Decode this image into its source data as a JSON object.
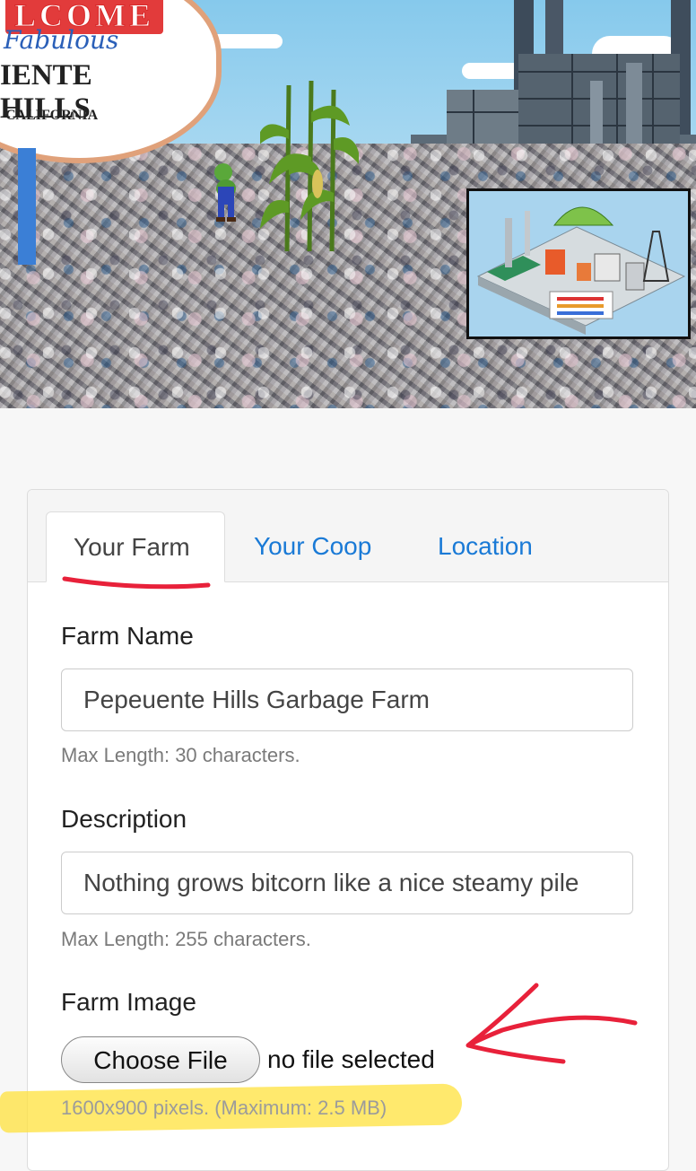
{
  "banner": {
    "sign": {
      "welcome": "LCOME",
      "fabulous": "Fabulous",
      "place": "IENTE HILLS",
      "state": "CALIFORNIA"
    }
  },
  "tabs": [
    {
      "label": "Your Farm",
      "active": true
    },
    {
      "label": "Your Coop",
      "active": false
    },
    {
      "label": "Location",
      "active": false
    }
  ],
  "form": {
    "farm_name": {
      "label": "Farm Name",
      "value": "Pepeuente Hills Garbage Farm",
      "help": "Max Length: 30 characters."
    },
    "description": {
      "label": "Description",
      "value": "Nothing grows bitcorn like a nice steamy pile",
      "help": "Max Length: 255 characters."
    },
    "farm_image": {
      "label": "Farm Image",
      "button": "Choose File",
      "status": "no file selected",
      "help": "1600x900 pixels. (Maximum: 2.5 MB)"
    }
  },
  "colors": {
    "tab_link": "#1a7ad6",
    "annotation_red": "#e8213a",
    "highlight_yellow": "#ffe23c"
  }
}
